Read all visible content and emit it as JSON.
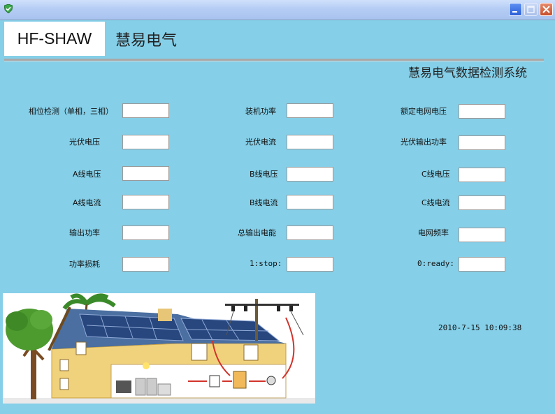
{
  "window": {
    "icons": {
      "app": "shield-check-icon",
      "minimize": "minimize-icon",
      "maximize": "maximize-icon",
      "close": "close-icon"
    }
  },
  "header": {
    "brand": "HF-SHAW",
    "company": "慧易电气",
    "system_title": "慧易电气数据检测系统"
  },
  "fields": {
    "phase_detect": {
      "label": "相位检测（单相，三相）",
      "value": ""
    },
    "installed_power": {
      "label": "装机功率",
      "value": ""
    },
    "rated_grid_voltage": {
      "label": "额定电网电压",
      "value": ""
    },
    "pv_voltage": {
      "label": "光伏电压",
      "value": ""
    },
    "pv_current": {
      "label": "光伏电流",
      "value": ""
    },
    "pv_output_power": {
      "label": "光伏输出功率",
      "value": ""
    },
    "a_voltage": {
      "label": "A线电压",
      "value": ""
    },
    "b_voltage": {
      "label": "B线电压",
      "value": ""
    },
    "c_voltage": {
      "label": "C线电压",
      "value": ""
    },
    "a_current": {
      "label": "A线电流",
      "value": ""
    },
    "b_current": {
      "label": "B线电流",
      "value": ""
    },
    "c_current": {
      "label": "C线电流",
      "value": ""
    },
    "output_power": {
      "label": "输出功率",
      "value": ""
    },
    "total_output_energy": {
      "label": "总输出电能",
      "value": ""
    },
    "grid_frequency": {
      "label": "电网频率",
      "value": ""
    },
    "power_loss": {
      "label": "功率损耗",
      "value": ""
    },
    "stop_flag": {
      "label": "1:stop:",
      "value": ""
    },
    "ready_flag": {
      "label": "0:ready:",
      "value": ""
    }
  },
  "status": {
    "datetime": "2010-7-15 10:09:38"
  },
  "illustration": {
    "icon": "solar-house-illustration"
  }
}
